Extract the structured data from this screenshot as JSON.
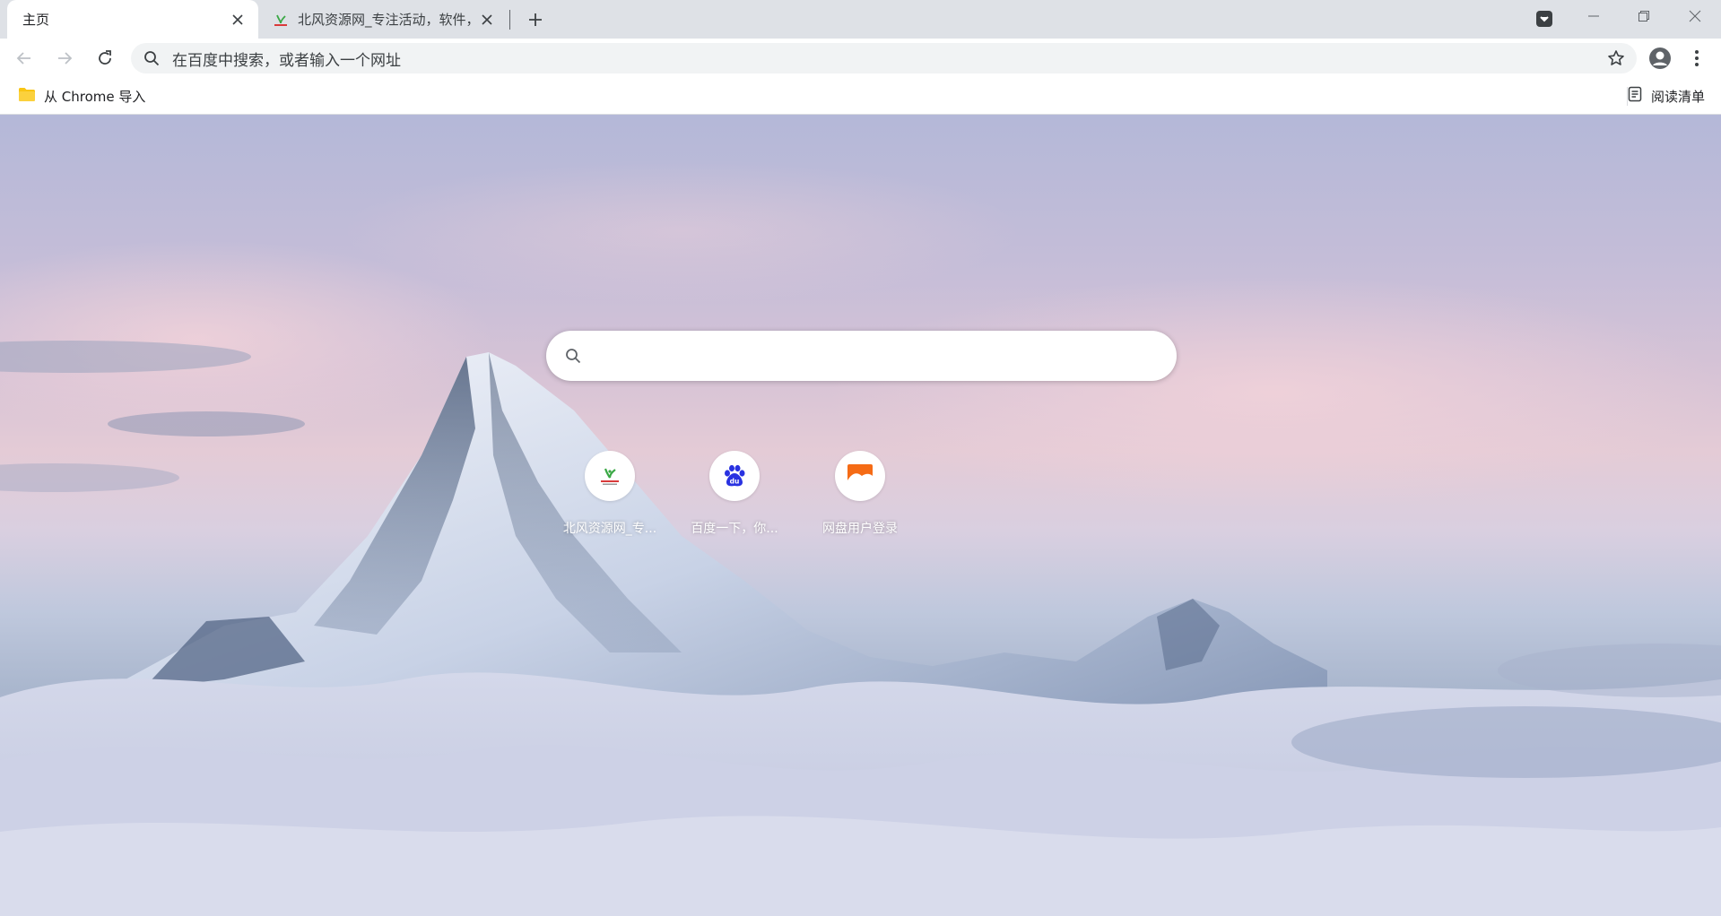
{
  "tabs": [
    {
      "title": "主页",
      "active": true
    },
    {
      "title": "北风资源网_专注活动，软件，",
      "active": false
    }
  ],
  "toolbar": {
    "omnibox_placeholder": "在百度中搜索，或者输入一个网址"
  },
  "bookmarks": {
    "items": [
      {
        "label": "从 Chrome 导入",
        "icon": "folder-icon"
      }
    ],
    "reading_list_label": "阅读清单"
  },
  "ntp": {
    "search_placeholder": "",
    "shortcuts": [
      {
        "title": "北风资源网_专...",
        "icon": "beifeng-favicon"
      },
      {
        "title": "百度一下，你...",
        "icon": "baidu-favicon"
      },
      {
        "title": "网盘用户登录",
        "icon": "netdisk-favicon"
      }
    ]
  },
  "colors": {
    "tabstrip": "#dee1e6",
    "omnibox": "#f1f3f4",
    "folder": "#f9c513",
    "baidu": "#2932e1",
    "netdisk": "#f56b15"
  }
}
